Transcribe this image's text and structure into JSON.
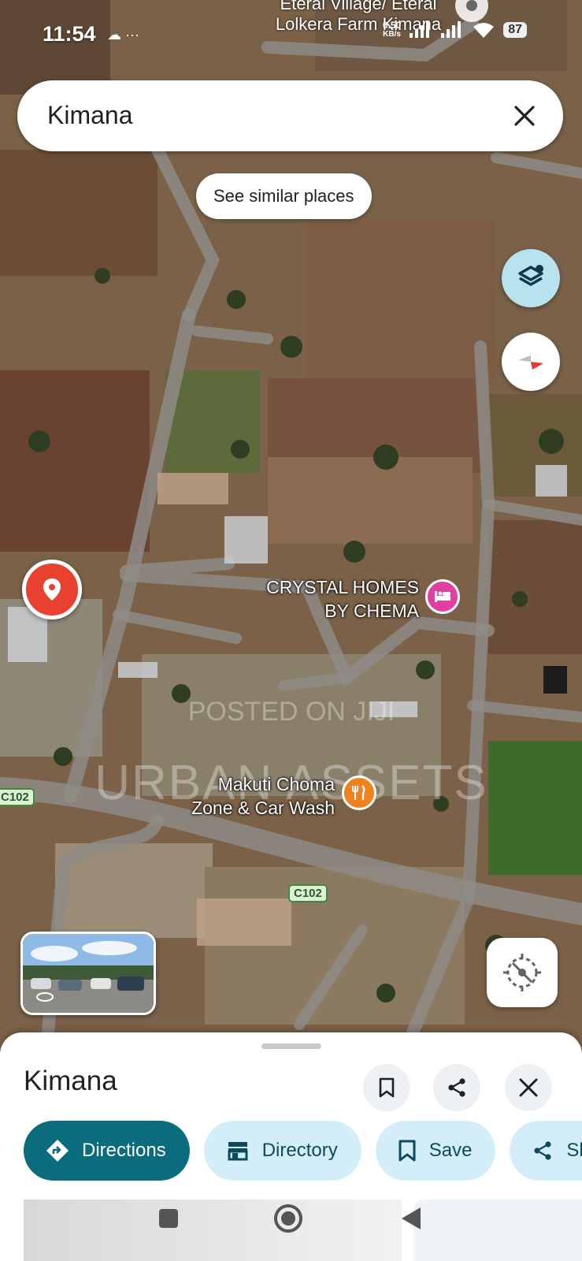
{
  "status_bar": {
    "time": "11:54",
    "net_speed": "0.50",
    "net_unit": "KB/s",
    "battery": "87"
  },
  "search": {
    "query": "Kimana"
  },
  "chip": {
    "label": "See similar places"
  },
  "map": {
    "top_labels": [
      "Eteral Village/ Eteral",
      "Lolkera Farm Kimana"
    ],
    "pois": [
      {
        "line1": "CRYSTAL HOMES",
        "line2": "BY CHEMA",
        "icon": "hotel-bed-icon",
        "color": "#e040a0"
      },
      {
        "line1": "Makuti Choma",
        "line2": "Zone & Car Wash",
        "icon": "restaurant-icon",
        "color": "#f0821e"
      }
    ],
    "road_badges": [
      "C102",
      "C102"
    ],
    "watermark": {
      "line1": "POSTED ON JIJI",
      "line2": "URBAN ASSETS"
    }
  },
  "sheet": {
    "title": "Kimana",
    "actions": [
      {
        "label": "Directions",
        "icon": "directions-icon"
      },
      {
        "label": "Directory",
        "icon": "store-icon"
      },
      {
        "label": "Save",
        "icon": "bookmark-icon"
      },
      {
        "label": "Sh",
        "icon": "share-icon"
      }
    ]
  },
  "colors": {
    "accent": "#0b6c7e",
    "pill_bg": "#d3eef8",
    "pin": "#e8412f"
  }
}
